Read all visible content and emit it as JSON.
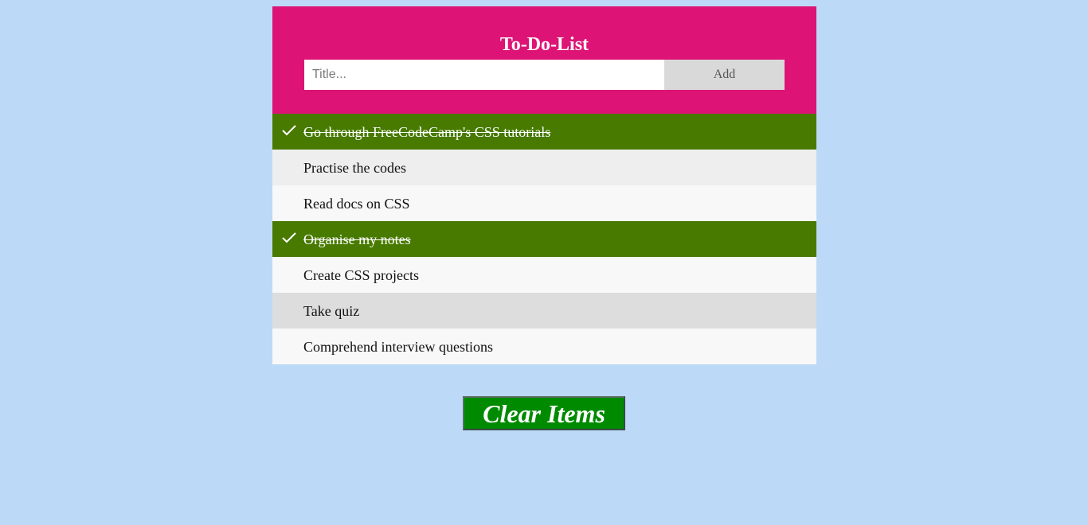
{
  "header": {
    "title": "To-Do-List",
    "input_placeholder": "Title...",
    "input_value": "",
    "add_label": "Add"
  },
  "items": [
    {
      "label": "Go through FreeCodeCamp's CSS tutorials",
      "checked": true
    },
    {
      "label": "Practise the codes",
      "checked": false
    },
    {
      "label": "Read docs on CSS",
      "checked": false
    },
    {
      "label": "Organise my notes",
      "checked": true
    },
    {
      "label": "Create CSS projects",
      "checked": false
    },
    {
      "label": "Take quiz",
      "checked": false
    },
    {
      "label": "Comprehend interview questions",
      "checked": false
    }
  ],
  "clear_button_label": "Clear Items",
  "colors": {
    "background": "#bcd9f7",
    "header": "#dd1476",
    "checked_item": "#487a00",
    "clear_button": "#008a00"
  },
  "icons": {
    "checked_marker": "check-icon"
  }
}
